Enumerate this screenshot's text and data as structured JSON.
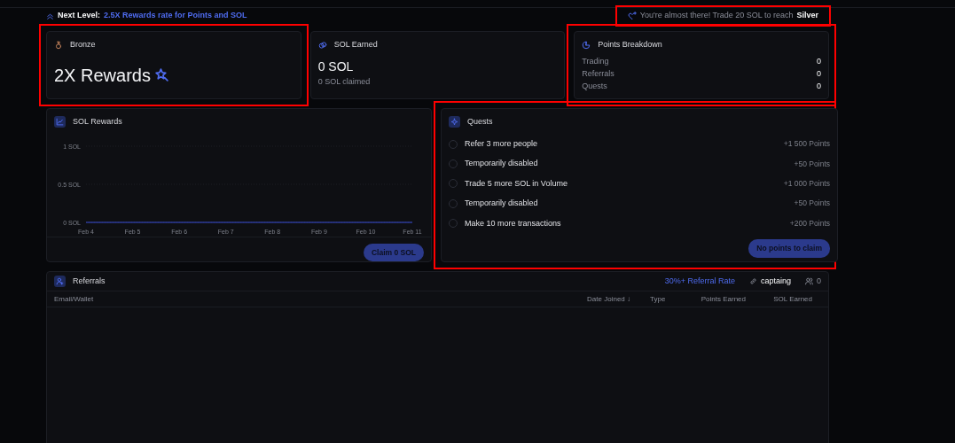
{
  "next_level": {
    "label": "Next Level:",
    "text": "2.5X Rewards rate for Points and SOL"
  },
  "progress_notice": {
    "text": "You're almost there! Trade 20 SOL to reach",
    "target": "Silver",
    "highlighted": true
  },
  "tier_card": {
    "tier": "Bronze",
    "headline": "2X Rewards",
    "highlighted": true
  },
  "sol_card": {
    "title": "SOL Earned",
    "value": "0 SOL",
    "sub": "0 SOL claimed",
    "highlighted": false
  },
  "points_card": {
    "title": "Points Breakdown",
    "highlighted": true,
    "rows": [
      {
        "label": "Trading",
        "value": "0"
      },
      {
        "label": "Referrals",
        "value": "0"
      },
      {
        "label": "Quests",
        "value": "0"
      }
    ]
  },
  "sol_rewards": {
    "title": "SOL Rewards",
    "button": "Claim 0 SOL",
    "highlighted": false,
    "chart_data": {
      "type": "line",
      "categories": [
        "Feb 4",
        "Feb 5",
        "Feb 6",
        "Feb 7",
        "Feb 8",
        "Feb 9",
        "Feb 10",
        "Feb 11"
      ],
      "series": [
        {
          "color": "#3b4fd8",
          "values": [
            0,
            0,
            0,
            0,
            0,
            0,
            0,
            0
          ]
        }
      ],
      "ylim": [
        0,
        1
      ],
      "yticks": [
        {
          "value": 0,
          "label": "0 SOL"
        },
        {
          "value": 0.5,
          "label": "0.5 SOL"
        },
        {
          "value": 1,
          "label": "1 SOL"
        }
      ]
    }
  },
  "quests": {
    "title": "Quests",
    "button": "No points to claim",
    "highlighted": true,
    "items": [
      {
        "text": "Refer 3 more people",
        "reward": "+1 500 Points",
        "completed": false
      },
      {
        "text": "Temporarily disabled",
        "reward": "+50 Points",
        "completed": false
      },
      {
        "text": "Trade 5 more SOL in Volume",
        "reward": "+1 000 Points",
        "completed": false
      },
      {
        "text": "Temporarily disabled",
        "reward": "+50 Points",
        "completed": false
      },
      {
        "text": "Make 10 more transactions",
        "reward": "+200 Points",
        "completed": false
      }
    ]
  },
  "referrals": {
    "title": "Referrals",
    "rate": "30%+ Referral Rate",
    "code": "captaing",
    "count": "0",
    "columns": [
      "Email/Wallet",
      "Date Joined ↓",
      "Type",
      "Points Earned",
      "SOL Earned"
    ]
  }
}
